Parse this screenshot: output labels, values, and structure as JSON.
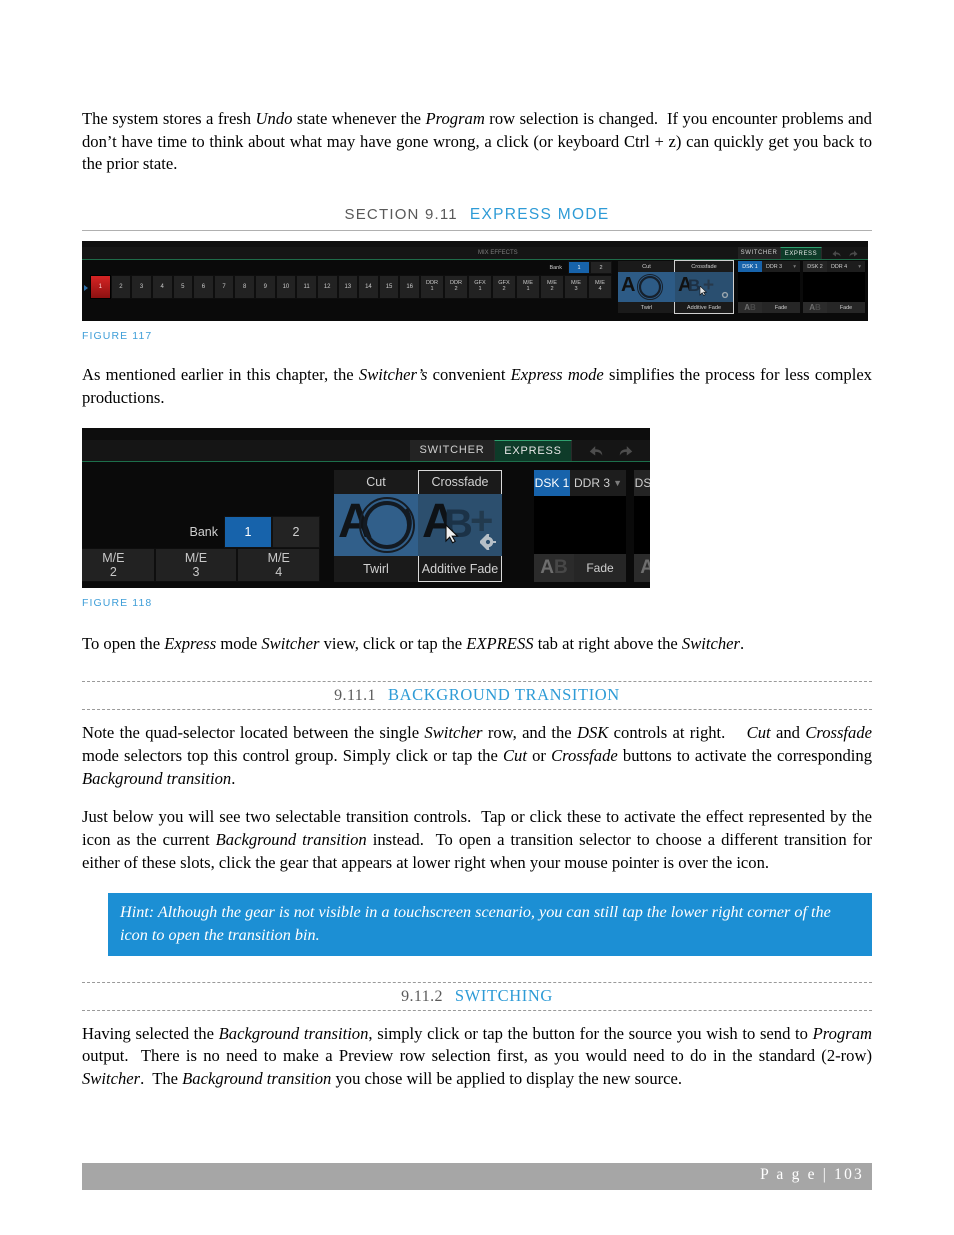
{
  "paragraphs": {
    "intro": "The system stores a fresh Undo state whenever the Program row selection is changed.  If you encounter problems and don’t have time to think about what may have gone wrong, a click (or keyboard Ctrl + z) can quickly get you back to the prior state.",
    "after_fig117": "As mentioned earlier in this chapter, the Switcher’s convenient Express mode simplifies the process for less complex productions.",
    "after_fig118": "To open the Express mode Switcher view, click or tap the EXPRESS tab at right above the Switcher.",
    "bg_trans_1": "Note the quad-selector located between the single Switcher row, and the DSK controls at right.    Cut and Crossfade mode selectors top this control group. Simply click or tap the Cut or Crossfade buttons to activate the corresponding Background transition.",
    "bg_trans_2": "Just below you will see two selectable transition controls.  Tap or click these to activate the effect represented by the icon as the current Background transition instead.  To open a transition selector to choose a different transition for either of these slots, click the gear that appears at lower right when your mouse pointer is over the icon.",
    "hint": "Hint: Although the gear is not visible in a touchscreen scenario, you can still tap the lower right corner of the icon to open the transition bin.",
    "switching": "Having selected the Background transition, simply click or tap the button for the source you wish to send to Program output.  There is no need to make a Preview row selection first, as you would need to do in the standard (2-row) Switcher.  The Background transition you chose will be applied to display the new source."
  },
  "headings": {
    "section": {
      "number": "SECTION 9.11",
      "title": "EXPRESS MODE"
    },
    "sub1": {
      "number": "9.11.1",
      "title": "BACKGROUND TRANSITION"
    },
    "sub2": {
      "number": "9.11.2",
      "title": "SWITCHING"
    }
  },
  "captions": {
    "fig117": "FIGURE 117",
    "fig118": "FIGURE 118"
  },
  "footer": {
    "page_label": "P a g e  | 103"
  },
  "colors": {
    "link_blue": "#2e9bd6",
    "hint_bg": "#1c8fd4",
    "accent_select_blue": "#1763ab",
    "program_red": "#d62424",
    "express_green": "#0e3b29"
  },
  "switcher_ui": {
    "me_label": "MIX EFFECTS",
    "tabs": [
      {
        "label": "SWITCHER",
        "active": false
      },
      {
        "label": "EXPRESS",
        "active": true
      }
    ],
    "undo_icon": "undo-arrow-icon",
    "redo_icon": "redo-arrow-icon",
    "source_row": [
      {
        "label": "1",
        "selected": true
      },
      {
        "label": "2",
        "selected": false
      },
      {
        "label": "3",
        "selected": false
      },
      {
        "label": "4",
        "selected": false
      },
      {
        "label": "5",
        "selected": false
      },
      {
        "label": "6",
        "selected": false
      },
      {
        "label": "7",
        "selected": false
      },
      {
        "label": "8",
        "selected": false
      },
      {
        "label": "9",
        "selected": false
      },
      {
        "label": "10",
        "selected": false
      },
      {
        "label": "11",
        "selected": false
      },
      {
        "label": "12",
        "selected": false
      },
      {
        "label": "13",
        "selected": false
      },
      {
        "label": "14",
        "selected": false
      },
      {
        "label": "15",
        "selected": false
      },
      {
        "label": "16",
        "selected": false
      }
    ],
    "source_row_2line": [
      {
        "l1": "DDR",
        "l2": "1"
      },
      {
        "l1": "DDR",
        "l2": "2"
      },
      {
        "l1": "GFX",
        "l2": "1"
      },
      {
        "l1": "GFX",
        "l2": "2"
      },
      {
        "l1": "M/E",
        "l2": "1"
      },
      {
        "l1": "M/E",
        "l2": "2"
      },
      {
        "l1": "M/E",
        "l2": "3"
      },
      {
        "l1": "M/E",
        "l2": "4"
      }
    ],
    "bank": {
      "label": "Bank",
      "buttons": [
        {
          "label": "1",
          "selected": true
        },
        {
          "label": "2",
          "selected": false
        }
      ]
    },
    "me_quad": [
      {
        "l1": "M/E",
        "l2": "2"
      },
      {
        "l1": "M/E",
        "l2": "3"
      },
      {
        "l1": "M/E",
        "l2": "4"
      }
    ],
    "transitions": [
      {
        "mode": "Cut",
        "name": "Twirl",
        "selected": false,
        "icon": "twirl-transition-icon"
      },
      {
        "mode": "Crossfade",
        "name": "Additive Fade",
        "selected": true,
        "icon": "additive-fade-transition-icon"
      }
    ],
    "dsk": [
      {
        "button": "DSK 1",
        "active": true,
        "source": "DDR 3",
        "fade_label": "Fade",
        "ab_icon": "ab-transition-icon"
      },
      {
        "button": "DSK 2",
        "active": false,
        "source": "DDR 4",
        "fade_label": "Fade",
        "ab_icon": "ab-transition-icon"
      }
    ],
    "gear_icon": "gear-icon",
    "pointer_icon": "mouse-pointer-icon",
    "plus_icon": "plus-icon"
  }
}
